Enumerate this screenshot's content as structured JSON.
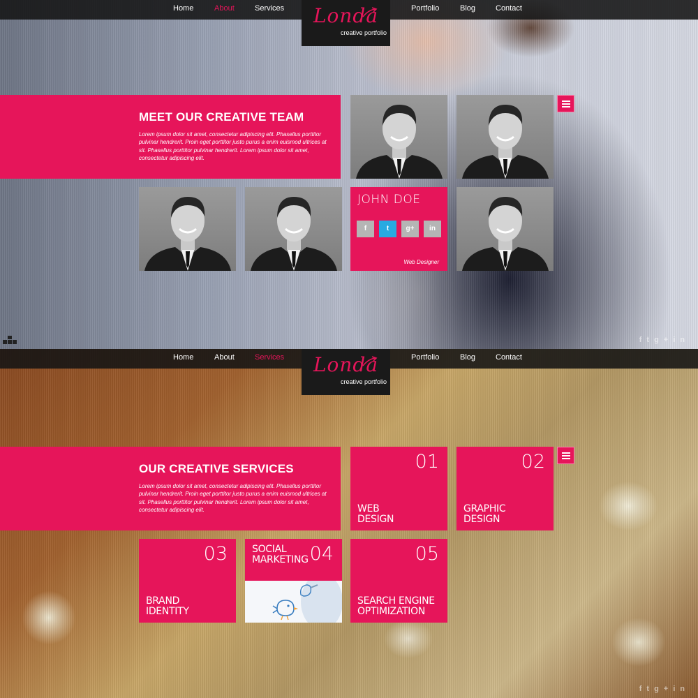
{
  "nav": {
    "items": [
      "Home",
      "About",
      "Services",
      "Portfolio",
      "Blog",
      "Contact"
    ]
  },
  "logo": {
    "word": "Londa",
    "tagline": "creative portfolio"
  },
  "about": {
    "active_nav": "About",
    "heading": "MEET OUR CREATIVE TEAM",
    "text": "Lorem ipsum dolor sit amet, consectetur adipiscing elit. Phasellus porttitor pulvinar hendrerit. Proin eget porttitor justo purus a enim euismod ultrices at sit. Phasellus porttitor pulvinar hendrerit. Lorem ipsum dolor sit amet, consectetur adipiscing elit.",
    "member": {
      "name": "JOHN DOE",
      "role": "Web Designer",
      "social": [
        "f",
        "t",
        "g+",
        "in"
      ]
    }
  },
  "services": {
    "active_nav": "Services",
    "heading": "OUR CREATIVE SERVICES",
    "text": "Lorem ipsum dolor sit amet, consectetur adipiscing elit. Phasellus porttitor pulvinar hendrerit. Proin eget porttitor justo purus a enim euismod ultrices at sit. Phasellus porttitor pulvinar hendrerit. Lorem ipsum dolor sit amet, consectetur adipiscing elit.",
    "items": [
      {
        "num": "01",
        "title_1": "WEB",
        "title_2": "DESIGN"
      },
      {
        "num": "02",
        "title_1": "GRAPHIC",
        "title_2": "DESIGN"
      },
      {
        "num": "03",
        "title_1": "BRAND",
        "title_2": "IDENTITY"
      },
      {
        "num": "04",
        "title_1": "SOCIAL",
        "title_2": "MARKETING"
      },
      {
        "num": "05",
        "title_1": "SEARCH ENGINE",
        "title_2": "OPTIMIZATION"
      }
    ]
  },
  "footer": {
    "social": [
      "f",
      "t",
      "g+",
      "in"
    ]
  },
  "colors": {
    "accent": "#e6155a",
    "nav_bg": "#141414",
    "twitter": "#28aae1"
  }
}
